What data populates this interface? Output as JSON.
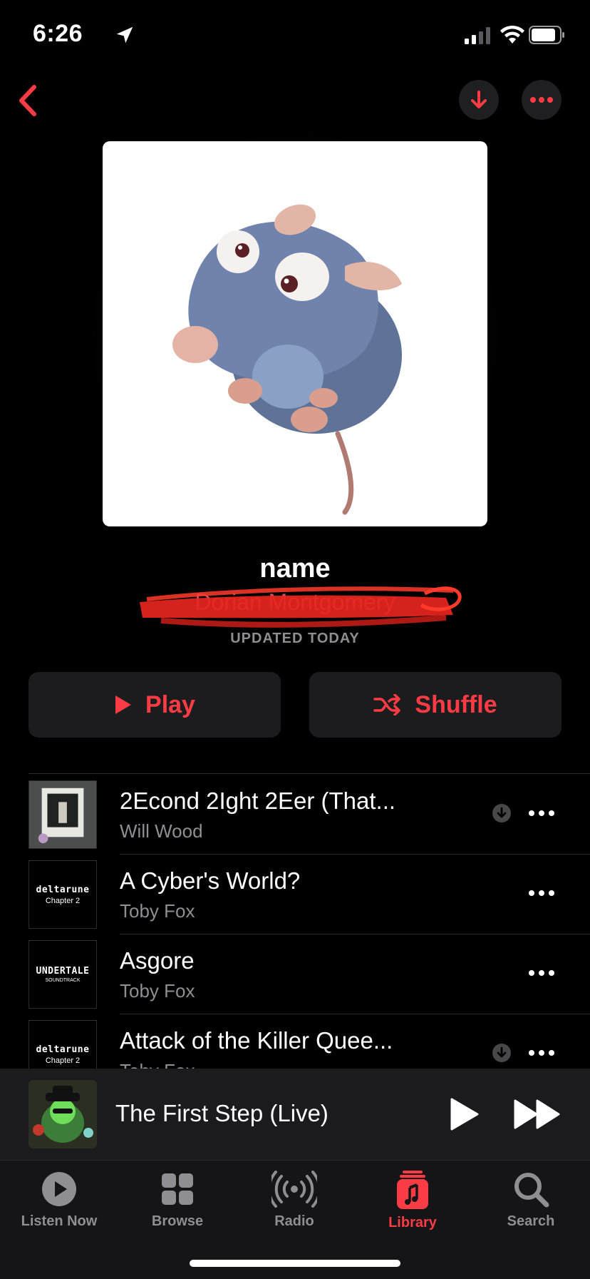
{
  "status": {
    "time": "6:26"
  },
  "playlist": {
    "title": "name",
    "curator": "Dorian Montgomery",
    "updated": "UPDATED TODAY"
  },
  "actions": {
    "play": "Play",
    "shuffle": "Shuffle"
  },
  "songs": [
    {
      "title": "2Econd 2Ight 2Eer (That...",
      "artist": "Will Wood",
      "downloaded": true,
      "thumb": ""
    },
    {
      "title": "A Cyber's World?",
      "artist": "Toby Fox",
      "downloaded": false,
      "thumb": "deltarune",
      "thumb_sub": "Chapter 2"
    },
    {
      "title": "Asgore",
      "artist": "Toby Fox",
      "downloaded": false,
      "thumb": "UNDERTALE",
      "thumb_sub": "SOUNDTRACK"
    },
    {
      "title": "Attack of the Killer Quee...",
      "artist": "Toby Fox",
      "downloaded": true,
      "thumb": "deltarune",
      "thumb_sub": "Chapter 2"
    }
  ],
  "now_playing": {
    "title": "The First Step (Live)"
  },
  "tabs": [
    {
      "label": "Listen Now",
      "icon": "play-circle-icon",
      "active": false
    },
    {
      "label": "Browse",
      "icon": "grid-icon",
      "active": false
    },
    {
      "label": "Radio",
      "icon": "radio-icon",
      "active": false
    },
    {
      "label": "Library",
      "icon": "music-note-icon",
      "active": true
    },
    {
      "label": "Search",
      "icon": "search-icon",
      "active": false
    }
  ],
  "colors": {
    "accent": "#fc3c44",
    "background": "#000000",
    "secondary_text": "#8e8e93"
  }
}
